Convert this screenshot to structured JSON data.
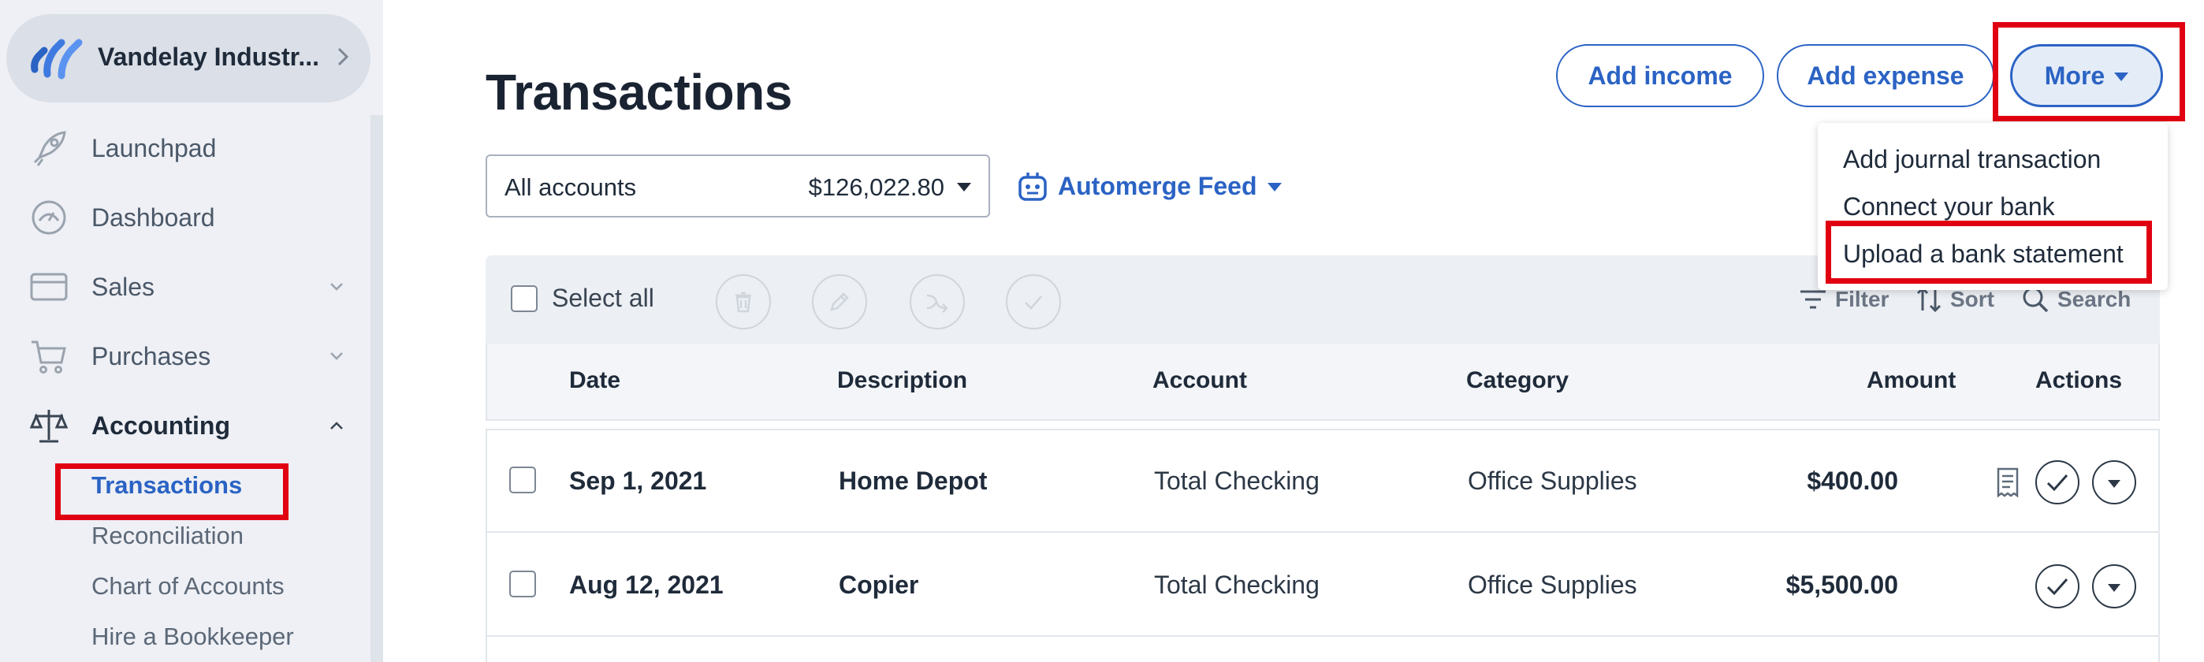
{
  "sidebar": {
    "business_name": "Vandelay Industr...",
    "items": [
      {
        "label": "Launchpad",
        "icon": "rocket-icon"
      },
      {
        "label": "Dashboard",
        "icon": "gauge-icon"
      },
      {
        "label": "Sales",
        "icon": "card-icon"
      },
      {
        "label": "Purchases",
        "icon": "cart-icon"
      },
      {
        "label": "Accounting",
        "icon": "scale-icon"
      }
    ],
    "accounting_sub": [
      "Transactions",
      "Reconciliation",
      "Chart of Accounts",
      "Hire a Bookkeeper"
    ]
  },
  "header": {
    "title": "Transactions",
    "add_income": "Add income",
    "add_expense": "Add expense",
    "more": "More"
  },
  "more_menu": [
    "Add journal transaction",
    "Connect your bank",
    "Upload a bank statement"
  ],
  "filters": {
    "account_name": "All accounts",
    "account_balance": "$126,022.80",
    "feed": "Automerge Feed"
  },
  "toolbar": {
    "select_all": "Select all",
    "filter": "Filter",
    "sort": "Sort",
    "search": "Search"
  },
  "table": {
    "columns": [
      "Date",
      "Description",
      "Account",
      "Category",
      "Amount",
      "Actions"
    ],
    "rows": [
      {
        "date": "Sep 1, 2021",
        "description": "Home Depot",
        "account": "Total Checking",
        "category": "Office Supplies",
        "amount": "$400.00",
        "has_receipt": true
      },
      {
        "date": "Aug 12, 2021",
        "description": "Copier",
        "account": "Total Checking",
        "category": "Office Supplies",
        "amount": "$5,500.00",
        "has_receipt": false
      }
    ]
  },
  "colors": {
    "accent": "#2b63c4",
    "highlight": "#e00012",
    "sidebar_bg": "#eef0f5"
  }
}
